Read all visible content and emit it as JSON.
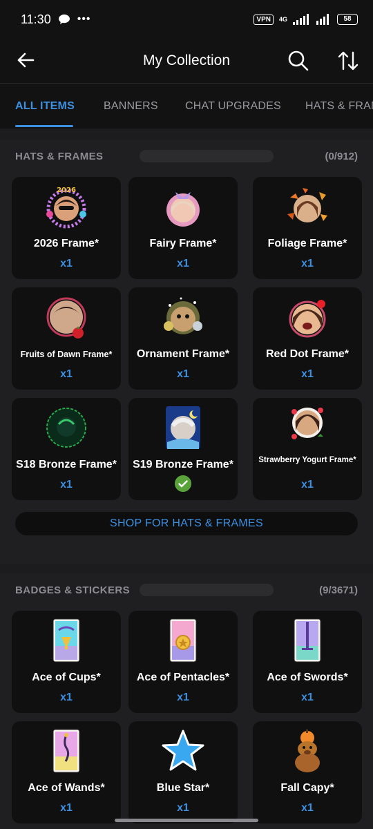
{
  "status": {
    "time": "11:30",
    "vpn": "VPN",
    "network": "4G",
    "battery": "58"
  },
  "app_bar": {
    "title": "My Collection"
  },
  "tabs": [
    {
      "label": "ALL ITEMS",
      "active": true
    },
    {
      "label": "BANNERS",
      "active": false
    },
    {
      "label": "CHAT UPGRADES",
      "active": false
    },
    {
      "label": "HATS & FRAMES",
      "active": false
    }
  ],
  "hats_frames": {
    "title": "HATS & FRAMES",
    "count": "(0/912)",
    "items": [
      {
        "name": "2026 Frame*",
        "qty": "x1",
        "icon": "frame-avatar-icon"
      },
      {
        "name": "Fairy Frame*",
        "qty": "x1",
        "icon": "frame-avatar-icon"
      },
      {
        "name": "Foliage Frame*",
        "qty": "x1",
        "icon": "frame-avatar-icon"
      },
      {
        "name": "Fruits of Dawn Frame*",
        "qty": "x1",
        "icon": "frame-avatar-icon"
      },
      {
        "name": "Ornament Frame*",
        "qty": "x1",
        "icon": "frame-avatar-icon"
      },
      {
        "name": "Red Dot Frame*",
        "qty": "x1",
        "icon": "frame-avatar-icon"
      },
      {
        "name": "S18 Bronze Frame*",
        "qty": "x1",
        "icon": "frame-avatar-icon"
      },
      {
        "name": "S19 Bronze Frame*",
        "qty": "",
        "icon": "frame-avatar-icon",
        "equipped": true
      },
      {
        "name": "Strawberry Yogurt Frame*",
        "qty": "x1",
        "icon": "frame-avatar-icon"
      }
    ],
    "shop_label": "SHOP FOR HATS & FRAMES"
  },
  "badges_stickers": {
    "title": "BADGES & STICKERS",
    "count": "(9/3671)",
    "items": [
      {
        "name": "Ace of Cups*",
        "qty": "x1",
        "icon": "tarot-card-icon"
      },
      {
        "name": "Ace of Pentacles*",
        "qty": "x1",
        "icon": "tarot-card-icon"
      },
      {
        "name": "Ace of Swords*",
        "qty": "x1",
        "icon": "tarot-card-icon"
      },
      {
        "name": "Ace of Wands*",
        "qty": "x1",
        "icon": "tarot-card-icon"
      },
      {
        "name": "Blue Star*",
        "qty": "x1",
        "icon": "blue-star-icon"
      },
      {
        "name": "Fall Capy*",
        "qty": "x1",
        "icon": "capybara-icon"
      }
    ]
  },
  "colors": {
    "accent": "#3d8fe0",
    "background": "#1c1c1e",
    "card": "#101011",
    "equipped": "#5aa33a"
  }
}
